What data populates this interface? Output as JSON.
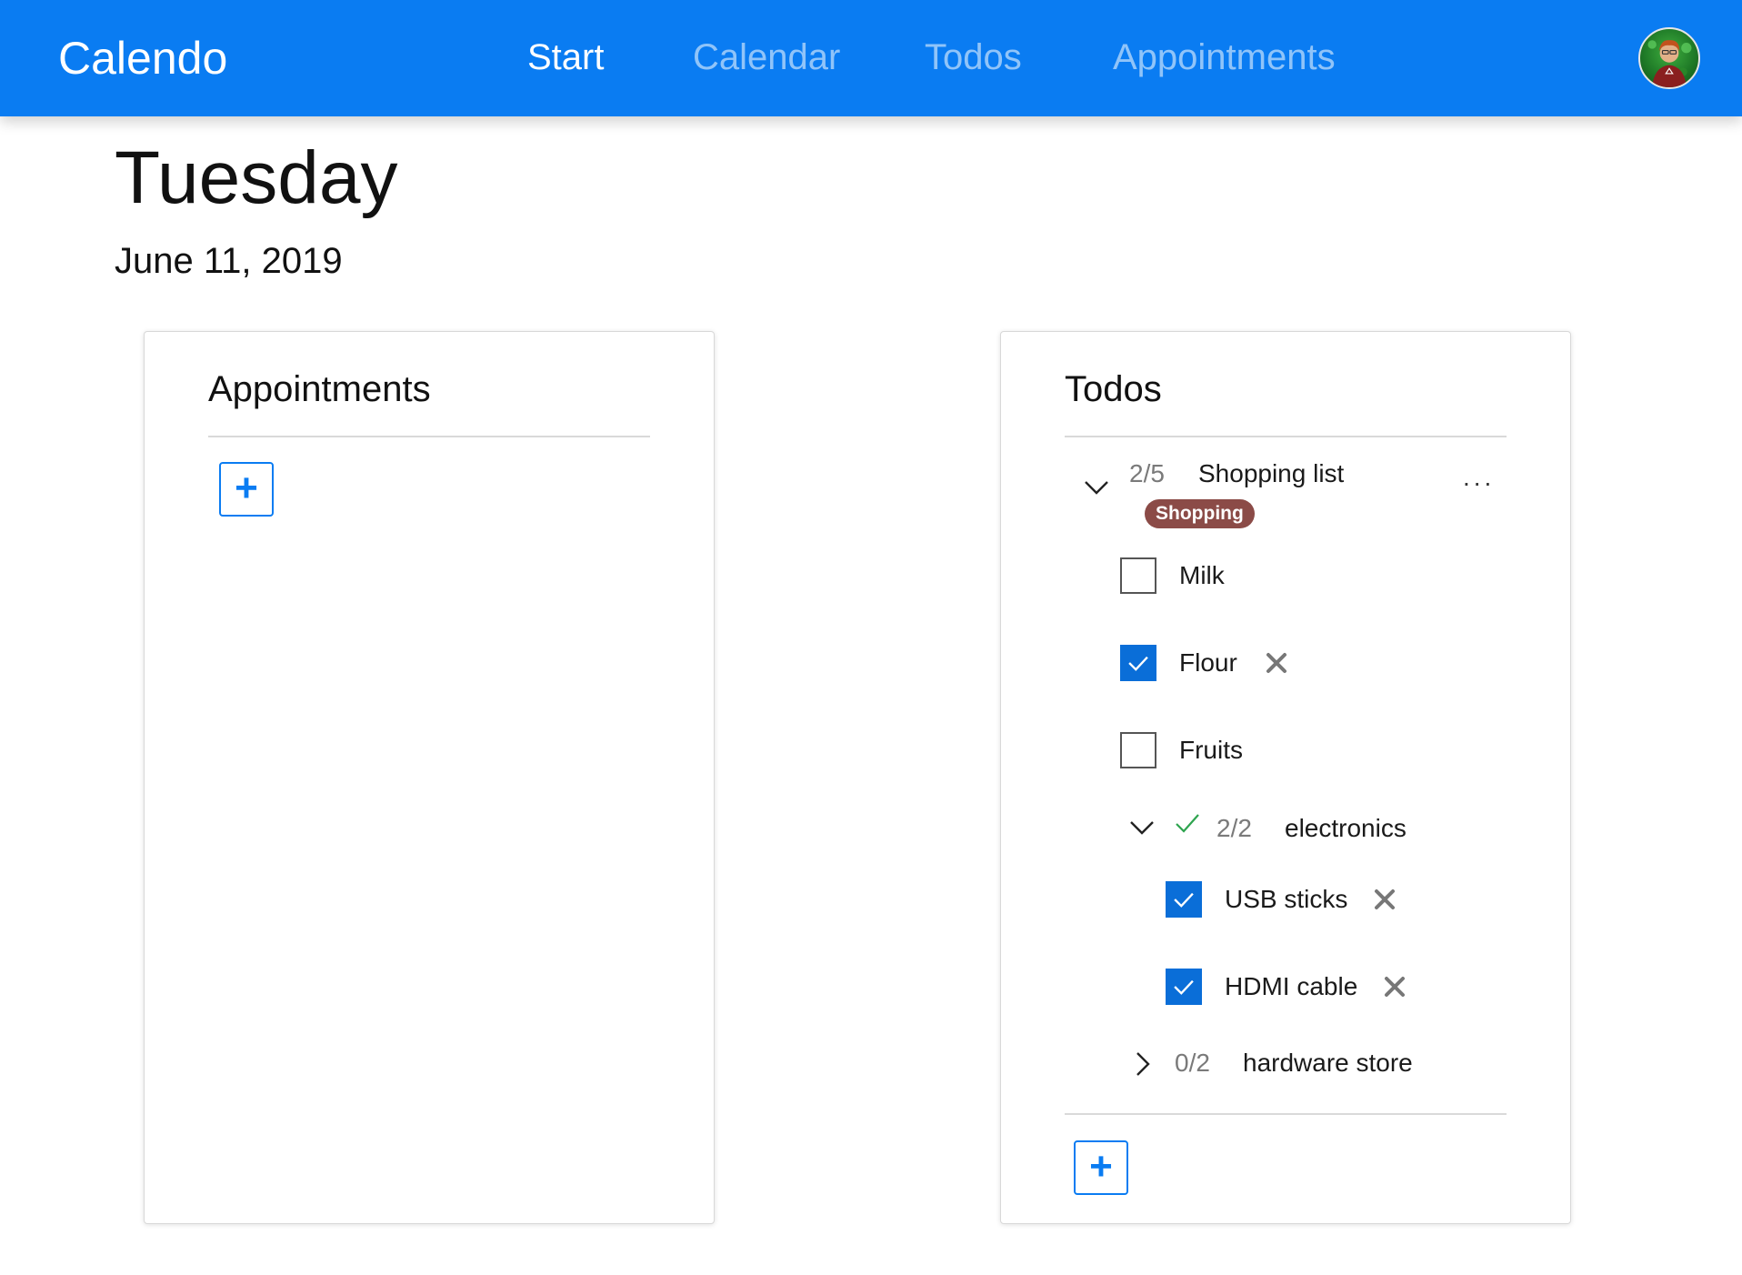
{
  "app": {
    "title": "Calendo"
  },
  "nav": {
    "items": [
      {
        "label": "Start",
        "active": true
      },
      {
        "label": "Calendar",
        "active": false
      },
      {
        "label": "Todos",
        "active": false
      },
      {
        "label": "Appointments",
        "active": false
      }
    ],
    "avatar_icon": "user-avatar"
  },
  "page": {
    "day": "Tuesday",
    "date": "June 11, 2019"
  },
  "appointments_card": {
    "title": "Appointments",
    "add_label": "+"
  },
  "todos_card": {
    "title": "Todos",
    "add_label": "+",
    "list": {
      "count": "2/5",
      "name": "Shopping list",
      "menu_label": "...",
      "tag": "Shopping",
      "tag_color": "#8b4b47",
      "expanded": true,
      "items": [
        {
          "label": "Milk",
          "checked": false
        },
        {
          "label": "Flour",
          "checked": true
        },
        {
          "label": "Fruits",
          "checked": false
        }
      ],
      "sublists": [
        {
          "count": "2/2",
          "name": "electronics",
          "expanded": true,
          "complete": true,
          "items": [
            {
              "label": "USB sticks",
              "checked": true
            },
            {
              "label": "HDMI cable",
              "checked": true
            }
          ]
        },
        {
          "count": "0/2",
          "name": "hardware store",
          "expanded": false,
          "complete": false
        }
      ]
    }
  },
  "colors": {
    "primary": "#0a7cf2",
    "checkbox_checked": "#0a6ed8",
    "complete_check": "#2ea44f"
  }
}
